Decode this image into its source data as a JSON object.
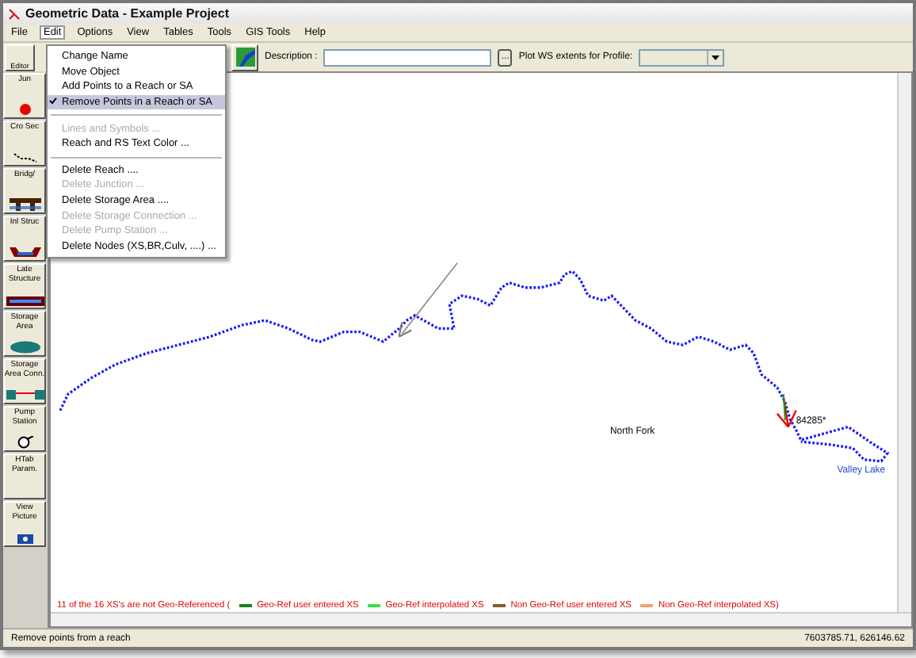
{
  "window": {
    "title": "Geometric Data - Example Project"
  },
  "menu_bar": [
    {
      "label": "File",
      "selected": false
    },
    {
      "label": "Edit",
      "selected": true
    },
    {
      "label": "Options",
      "selected": false
    },
    {
      "label": "View",
      "selected": false
    },
    {
      "label": "Tables",
      "selected": false
    },
    {
      "label": "Tools",
      "selected": false
    },
    {
      "label": "GIS Tools",
      "selected": false
    },
    {
      "label": "Help",
      "selected": false
    }
  ],
  "edit_menu": [
    {
      "kind": "item",
      "label": "Change Name",
      "disabled": false,
      "checked": false,
      "selected": false
    },
    {
      "kind": "item",
      "label": "Move Object",
      "disabled": false,
      "checked": false,
      "selected": false
    },
    {
      "kind": "item",
      "label": "Add Points to a Reach or SA",
      "disabled": false,
      "checked": false,
      "selected": false
    },
    {
      "kind": "item",
      "label": "Remove Points in a Reach or SA",
      "disabled": false,
      "checked": true,
      "selected": true
    },
    {
      "kind": "separator"
    },
    {
      "kind": "item",
      "label": "Lines and Symbols ...",
      "disabled": true,
      "checked": false,
      "selected": false
    },
    {
      "kind": "item",
      "label": "Reach and RS Text Color ...",
      "disabled": false,
      "checked": false,
      "selected": false
    },
    {
      "kind": "separator"
    },
    {
      "kind": "item",
      "label": "Delete Reach ....",
      "disabled": false,
      "checked": false,
      "selected": false
    },
    {
      "kind": "item",
      "label": "Delete Junction ...",
      "disabled": true,
      "checked": false,
      "selected": false
    },
    {
      "kind": "item",
      "label": "Delete Storage Area ....",
      "disabled": false,
      "checked": false,
      "selected": false
    },
    {
      "kind": "item",
      "label": "Delete Storage Connection ...",
      "disabled": true,
      "checked": false,
      "selected": false
    },
    {
      "kind": "item",
      "label": "Delete Pump Station ...",
      "disabled": true,
      "checked": false,
      "selected": false
    },
    {
      "kind": "item",
      "label": "Delete Nodes (XS,BR,Culv, ....) ...",
      "disabled": false,
      "checked": false,
      "selected": false
    }
  ],
  "toolbar": {
    "editors_label": "Editor",
    "description_label": "Description :",
    "browse_button": "...",
    "plot_label": "Plot WS extents for Profile:",
    "profile_dropdown": {
      "disabled": true
    }
  },
  "tools": [
    {
      "label": "Jun",
      "kind": "junction"
    },
    {
      "label": "Cro Sec",
      "kind": "cross-section"
    },
    {
      "label": "Bridg/",
      "kind": "bridge"
    },
    {
      "label": "Inl Struc",
      "kind": "inline"
    },
    {
      "label": "Late Structure",
      "kind": "lateral"
    },
    {
      "label": "Storage Area",
      "kind": "storage"
    },
    {
      "label": "Storage Area Conn.",
      "kind": "connection"
    },
    {
      "label": "Pump Station",
      "kind": "pump"
    },
    {
      "label": "HTab Param.",
      "kind": "plain"
    },
    {
      "label": "View Picture",
      "kind": "picture"
    }
  ],
  "map": {
    "labels": [
      {
        "text": "84285*"
      },
      {
        "text": "North Fork"
      },
      {
        "text": "Valley Lake"
      }
    ]
  },
  "legend": {
    "message": "11 of the 16 XS's are not Geo-Referenced (",
    "items": [
      {
        "label": "Geo-Ref user entered XS",
        "color": "#208020"
      },
      {
        "label": "Geo-Ref interpolated XS",
        "color": "#40e040"
      },
      {
        "label": "Non Geo-Ref user entered XS",
        "color": "#8b5a2b"
      },
      {
        "label": "Non Geo-Ref interpolated XS)",
        "color": "#f0a070"
      }
    ]
  },
  "status_bar": {
    "message": "Remove points from a reach",
    "coordinates": "7603785.71, 626146.62"
  }
}
